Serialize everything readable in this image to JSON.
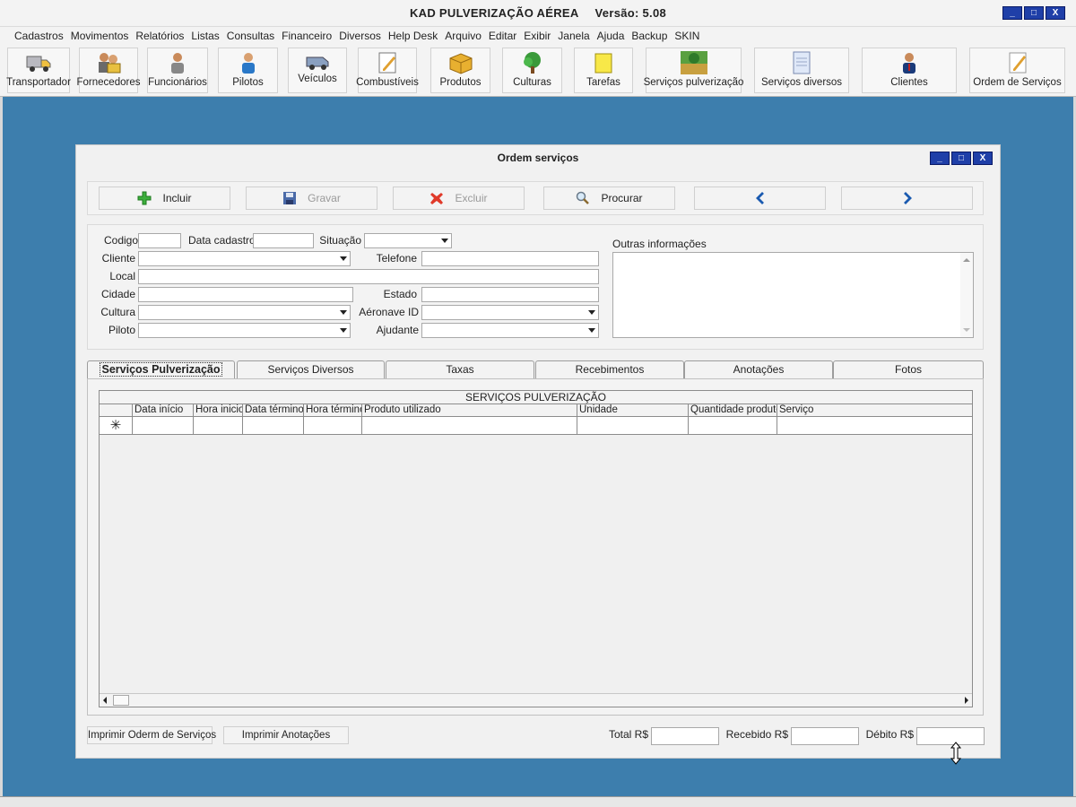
{
  "app": {
    "title": "KAD PULVERIZAÇÃO AÉREA",
    "version": "Versão: 5.08"
  },
  "window_buttons": {
    "minimize": "_",
    "maximize": "□",
    "close": "X"
  },
  "menu": [
    "Cadastros",
    "Movimentos",
    "Relatórios",
    "Listas",
    "Consultas",
    "Financeiro",
    "Diversos",
    "Help Desk",
    "Arquivo",
    "Editar",
    "Exibir",
    "Janela",
    "Ajuda",
    "Backup",
    "SKIN"
  ],
  "toolbar": [
    {
      "label": "Transportador",
      "icon": "truck-icon"
    },
    {
      "label": "Fornecedores",
      "icon": "suppliers-icon"
    },
    {
      "label": "Funcionários",
      "icon": "employee-icon"
    },
    {
      "label": "Pilotos",
      "icon": "pilot-icon"
    },
    {
      "label": "Veículos",
      "icon": "vehicle-icon"
    },
    {
      "label": "Combustíveis",
      "icon": "fuel-note-icon"
    },
    {
      "label": "Produtos",
      "icon": "box-icon"
    },
    {
      "label": "Culturas",
      "icon": "tree-icon"
    },
    {
      "label": "Tarefas",
      "icon": "sticky-note-icon"
    },
    {
      "label": "Serviços pulverização",
      "icon": "field-icon"
    },
    {
      "label": "Serviços diversos",
      "icon": "document-icon"
    },
    {
      "label": "Clientes",
      "icon": "client-icon"
    },
    {
      "label": "Ordem de Serviços",
      "icon": "pencil-note-icon"
    }
  ],
  "order_window": {
    "title": "Ordem serviços",
    "actions": {
      "incluir": "Incluir",
      "gravar": "Gravar",
      "excluir": "Excluir",
      "procurar": "Procurar"
    },
    "labels": {
      "codigo": "Codigo",
      "data_cadastro": "Data cadastro",
      "situacao": "Situação",
      "cliente": "Cliente",
      "telefone": "Telefone",
      "local": "Local",
      "cidade": "Cidade",
      "estado": "Estado",
      "cultura": "Cultura",
      "aeronave": "Aéronave ID",
      "piloto": "Piloto",
      "ajudante": "Ajudante",
      "outras": "Outras informações"
    },
    "values": {
      "codigo": "",
      "data_cadastro": "",
      "situacao": "",
      "cliente": "",
      "telefone": "",
      "local": "",
      "cidade": "",
      "estado": "",
      "cultura": "",
      "aeronave": "",
      "piloto": "",
      "ajudante": "",
      "outras": ""
    },
    "tabs": [
      "Serviços Pulverização",
      "Serviços Diversos",
      "Taxas",
      "Recebimentos",
      "Anotações",
      "Fotos"
    ],
    "grid": {
      "caption": "SERVIÇOS PULVERIZAÇÃO",
      "columns": [
        "Data início",
        "Hora inicio",
        "Data término",
        "Hora término",
        "Produto utilizado",
        "Unidade",
        "Quantidade produto",
        "Serviço"
      ],
      "new_row_marker": "✳"
    },
    "footer": {
      "print_order": "Imprimir Oderm  de Serviços",
      "print_notes": "Imprimir Anotações",
      "total_label": "Total R$",
      "recebido_label": "Recebido R$",
      "debito_label": "Débito R$",
      "total_value": "",
      "recebido_value": "",
      "debito_value": ""
    }
  }
}
